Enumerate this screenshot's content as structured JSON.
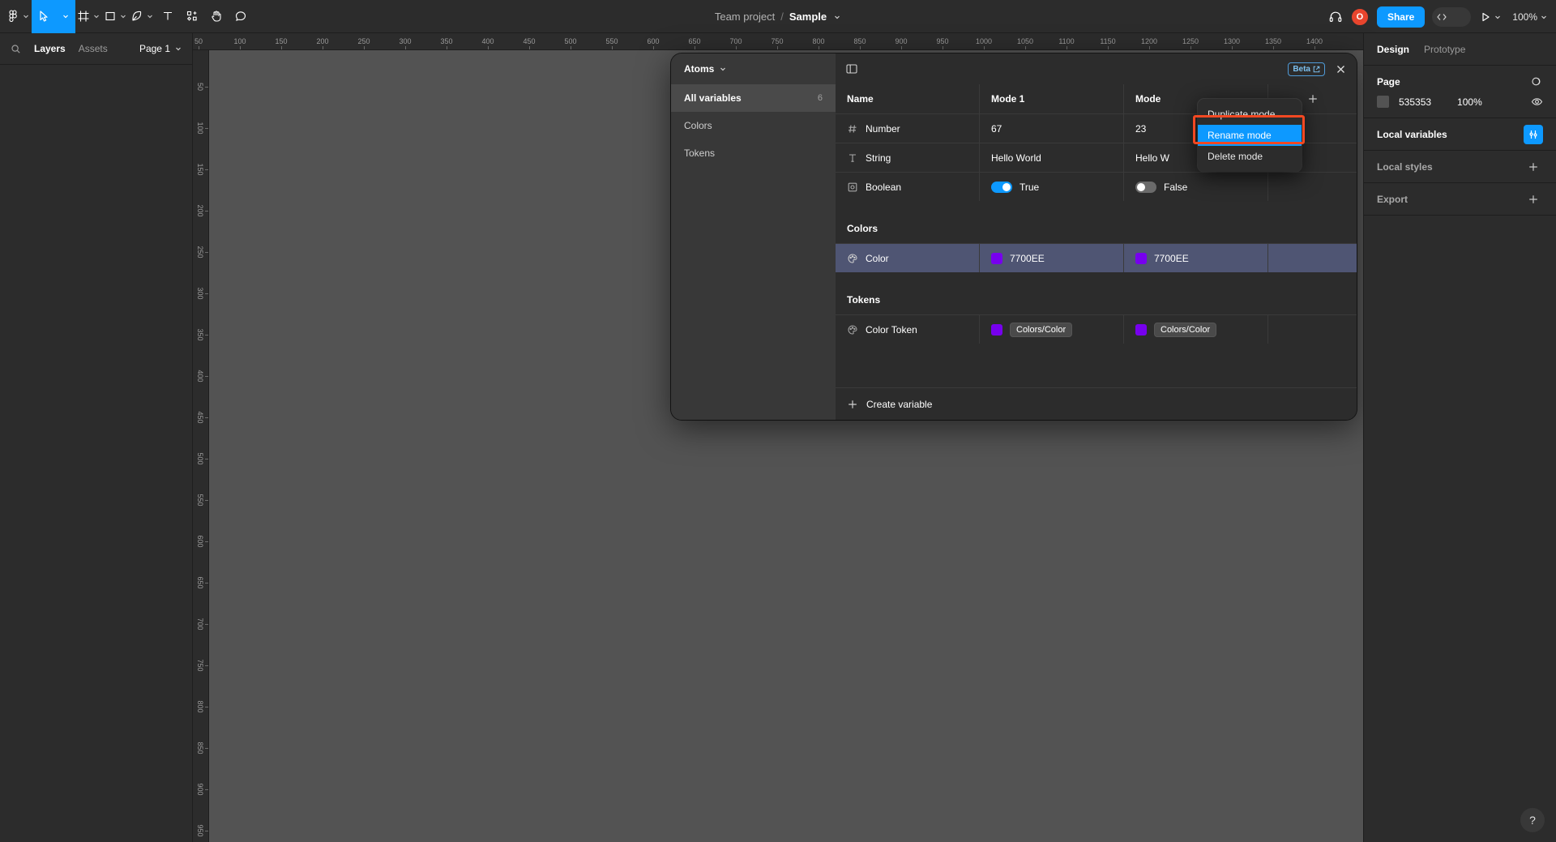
{
  "toolbar": {
    "tools": [
      {
        "name": "figma-logo-icon",
        "label": "Figma"
      },
      {
        "name": "move-tool",
        "label": "Move"
      },
      {
        "name": "frame-tool",
        "label": "Frame"
      },
      {
        "name": "shape-tool",
        "label": "Shape"
      },
      {
        "name": "pen-tool",
        "label": "Pen"
      },
      {
        "name": "text-tool",
        "label": "Text"
      },
      {
        "name": "components-tool",
        "label": "Components"
      },
      {
        "name": "hand-tool",
        "label": "Hand"
      },
      {
        "name": "comment-tool",
        "label": "Comment"
      }
    ],
    "breadcrumb_team": "Team project",
    "breadcrumb_sep": "/",
    "breadcrumb_file": "Sample",
    "avatar_initial": "O",
    "share_label": "Share",
    "zoom_level": "100%",
    "accent_blue": "#0d99ff",
    "avatar_color": "#e8452d"
  },
  "left_panel": {
    "tab_layers": "Layers",
    "tab_assets": "Assets",
    "page_name": "Page 1"
  },
  "rulers": {
    "horizontal": [
      "50",
      "100",
      "150",
      "200",
      "250",
      "300",
      "350",
      "400",
      "450",
      "500",
      "550",
      "600",
      "650",
      "700",
      "750",
      "800",
      "850",
      "900",
      "950",
      "1000",
      "1050",
      "1100",
      "1150",
      "1200",
      "1250",
      "1300",
      "1350",
      "1400"
    ],
    "vertical": [
      "50",
      "100",
      "150",
      "200",
      "250",
      "300",
      "350",
      "400",
      "450",
      "500",
      "550",
      "600",
      "650",
      "700",
      "750",
      "800",
      "850",
      "900",
      "950"
    ]
  },
  "canvas": {
    "background_color": "#535353"
  },
  "modal": {
    "collection_name": "Atoms",
    "sidebar_items": [
      {
        "label": "All variables",
        "count": "6",
        "active": true
      },
      {
        "label": "Colors",
        "count": "",
        "active": false
      },
      {
        "label": "Tokens",
        "count": "",
        "active": false
      }
    ],
    "beta_label": "Beta",
    "columns": {
      "name": "Name",
      "mode1": "Mode 1",
      "mode2": "Mode"
    },
    "rows": [
      {
        "icon": "number-icon",
        "name": "Number",
        "mode1": "67",
        "mode2": "23",
        "kind": "text"
      },
      {
        "icon": "string-icon",
        "name": "String",
        "mode1": "Hello World",
        "mode2": "Hello W",
        "kind": "text"
      },
      {
        "icon": "boolean-icon",
        "name": "Boolean",
        "mode1": "True",
        "mode2": "False",
        "kind": "boolean",
        "mode1_on": true,
        "mode2_on": false
      }
    ],
    "group_colors": "Colors",
    "color_rows": [
      {
        "icon": "palette-icon",
        "name": "Color",
        "mode1": "7700EE",
        "mode2": "7700EE",
        "swatch": "#7700EE",
        "selected": true
      }
    ],
    "group_tokens": "Tokens",
    "token_rows": [
      {
        "icon": "palette-icon",
        "name": "Color Token",
        "mode1": "Colors/Color",
        "mode2": "Colors/Color",
        "swatch": "#7700EE",
        "selected": false
      }
    ],
    "create_label": "Create variable"
  },
  "context_menu": {
    "items": [
      {
        "label": "Duplicate mode",
        "highlight": false
      },
      {
        "label": "Rename mode",
        "highlight": true
      },
      {
        "label": "Delete mode",
        "highlight": false
      }
    ],
    "highlight_color": "#0d99ff",
    "annotation_color": "#f24822"
  },
  "right_panel": {
    "tab_design": "Design",
    "tab_prototype": "Prototype",
    "page_label": "Page",
    "page_color_hex": "535353",
    "page_opacity": "100%",
    "local_variables_label": "Local variables",
    "local_styles_label": "Local styles",
    "export_label": "Export"
  },
  "help": {
    "label": "?"
  }
}
